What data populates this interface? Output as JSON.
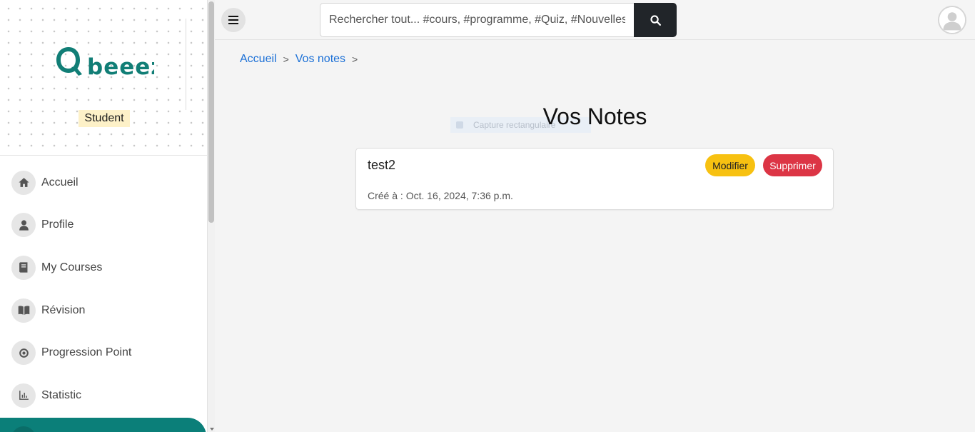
{
  "sidebar": {
    "logo_text": "Qbeeez",
    "role": "Student",
    "items": [
      {
        "label": "Accueil",
        "icon": "home-icon"
      },
      {
        "label": "Profile",
        "icon": "user-icon"
      },
      {
        "label": "My Courses",
        "icon": "book-icon"
      },
      {
        "label": "Révision",
        "icon": "open-book-icon"
      },
      {
        "label": "Progression Point",
        "icon": "target-icon"
      },
      {
        "label": "Statistic",
        "icon": "bar-chart-icon"
      }
    ],
    "accent_color": "#0b7f79"
  },
  "header": {
    "search_placeholder": "Rechercher tout... #cours, #programme, #Quiz, #Nouvelles",
    "search_icon": "search-icon",
    "menu_icon": "hamburger-icon",
    "avatar_icon": "user-avatar-icon"
  },
  "breadcrumb": {
    "items": [
      "Accueil",
      "Vos notes"
    ],
    "separator": ">"
  },
  "main": {
    "title": "Vos Notes",
    "ghost_overlay": "Capture rectangulaire",
    "notes": [
      {
        "title": "test2",
        "created": "Créé à : Oct. 16, 2024, 7:36 p.m.",
        "edit_label": "Modifier",
        "delete_label": "Supprimer"
      }
    ]
  },
  "colors": {
    "edit": "#f7c111",
    "delete": "#dc3545",
    "link": "#1a6fd6",
    "search_button": "#212529"
  }
}
